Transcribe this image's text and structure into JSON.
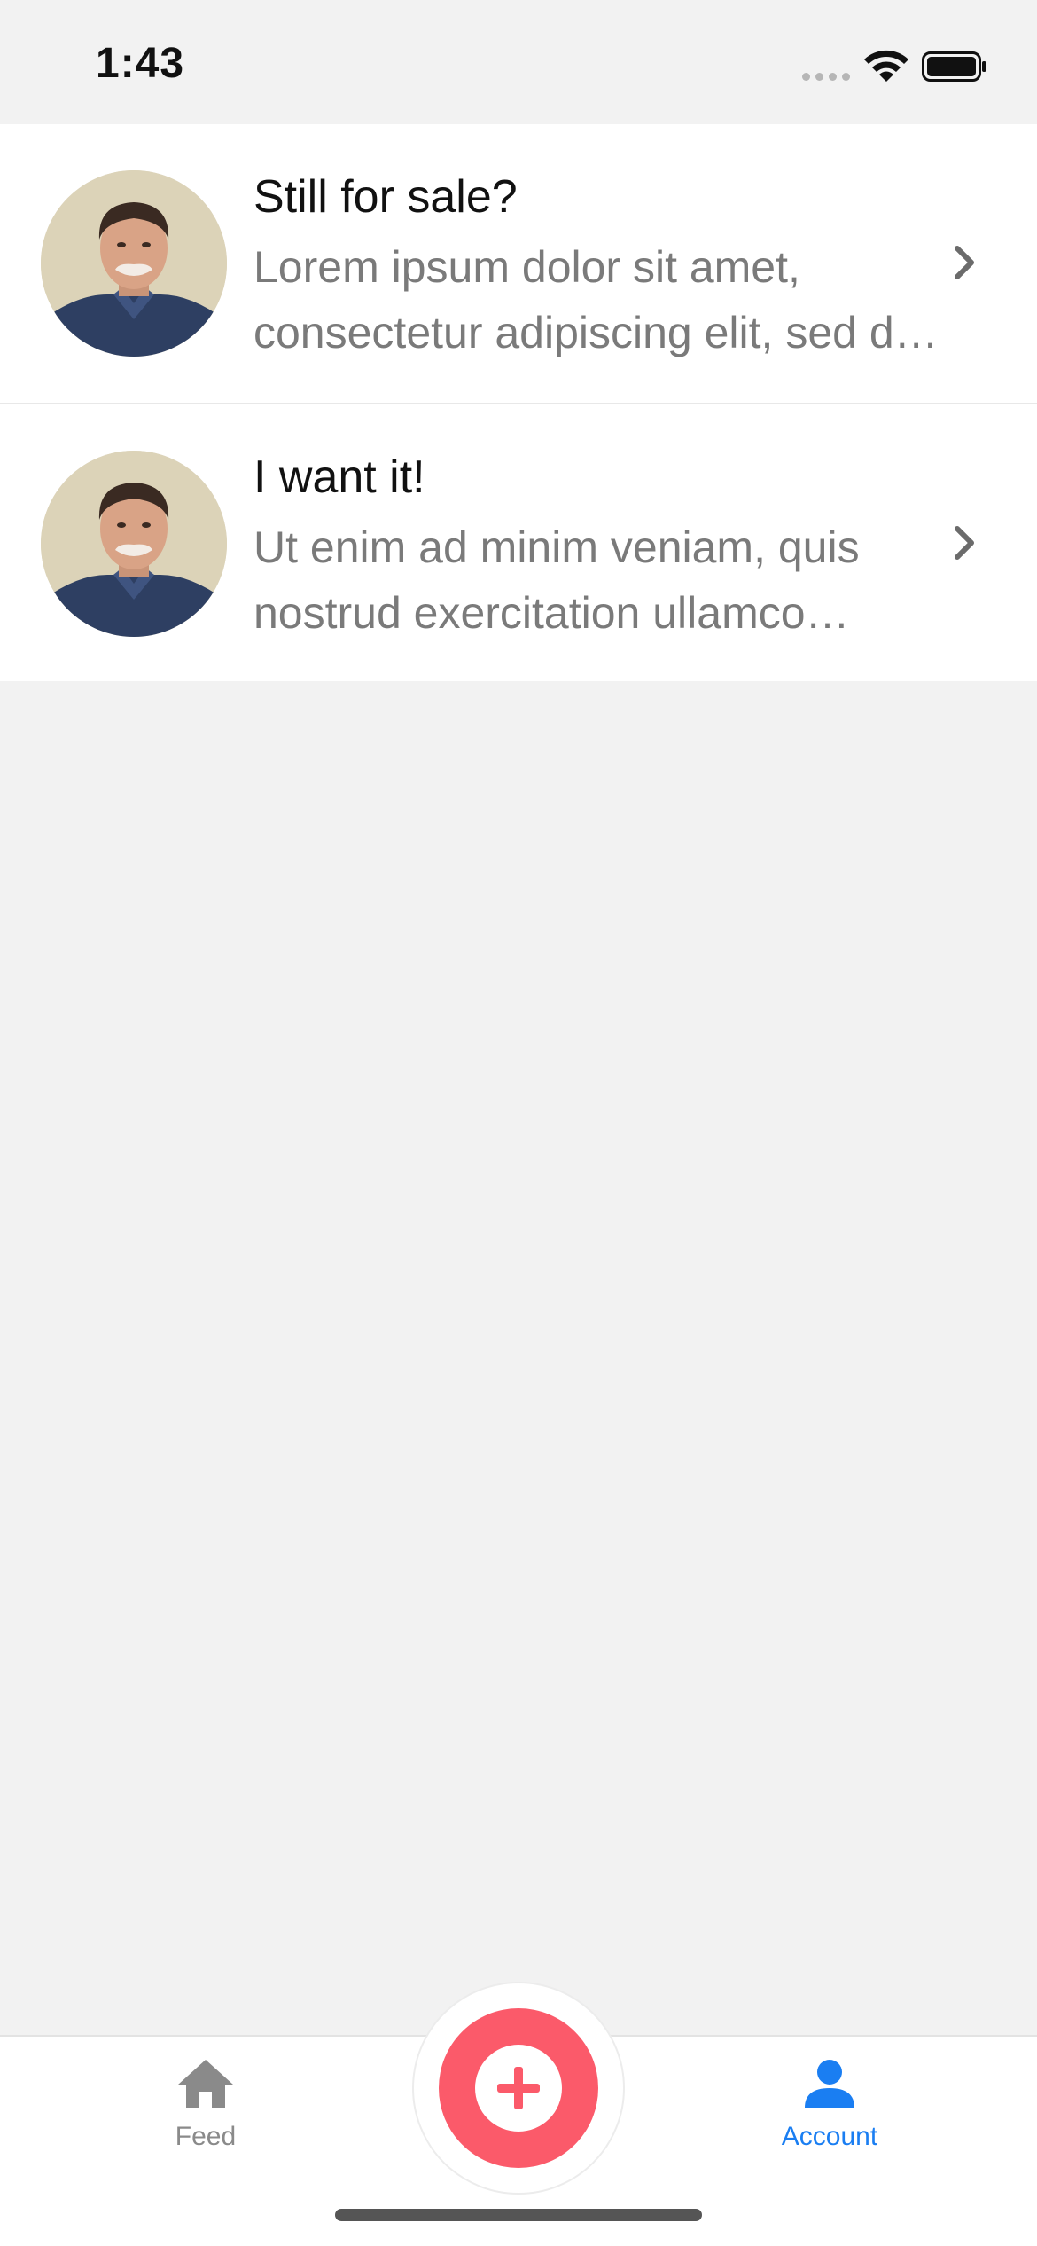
{
  "status_bar": {
    "time": "1:43",
    "icons": [
      "signal-dots-icon",
      "wifi-icon",
      "battery-icon"
    ]
  },
  "messages": [
    {
      "title": "Still for sale?",
      "preview": "Lorem ipsum dolor sit amet, consectetur adipiscing elit, sed do eiusmod tempor incididunt",
      "avatar": "profile-photo",
      "chevron": "chevron-right-icon"
    },
    {
      "title": "I want it!",
      "preview": "Ut enim ad minim veniam, quis nostrud exercitation ullamco laboris nisi ut aliquip",
      "avatar": "profile-photo",
      "chevron": "chevron-right-icon"
    }
  ],
  "tab_bar": {
    "feed_label": "Feed",
    "account_label": "Account",
    "feed_icon": "home-icon",
    "account_icon": "person-icon",
    "add_icon": "plus-icon",
    "active_tab": "Account"
  },
  "colors": {
    "accent": "#1a7ef2",
    "add_button": "#fb5a6a",
    "background": "#f2f2f2"
  }
}
